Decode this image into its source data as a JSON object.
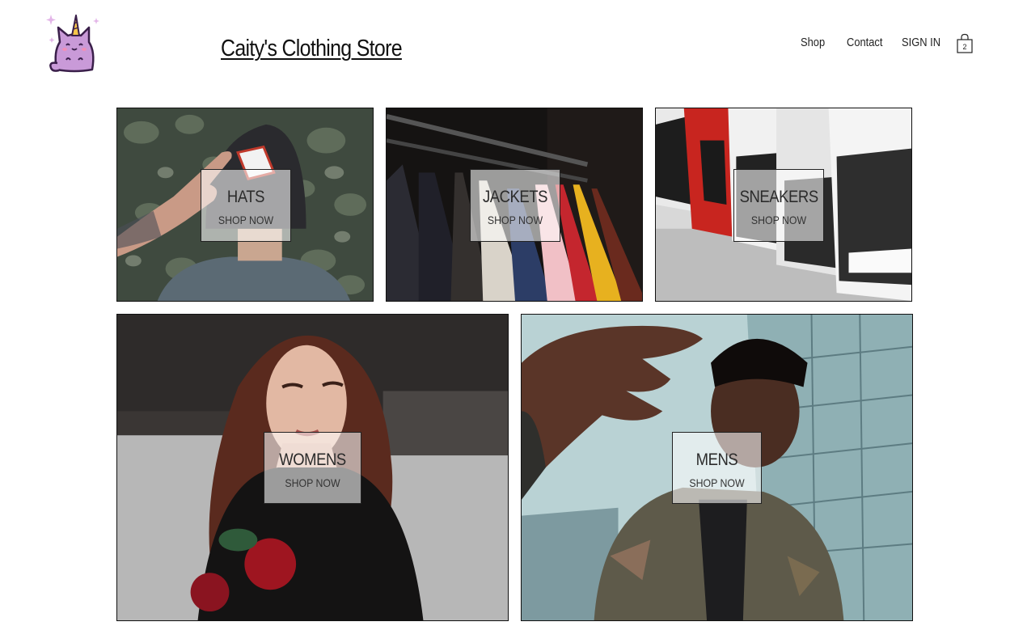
{
  "header": {
    "store_title": "Caity's Clothing Store",
    "logo_icon": "unicorn-cat-logo-icon",
    "nav": {
      "shop": "Shop",
      "contact": "Contact",
      "signin": "SIGN IN"
    },
    "cart": {
      "icon": "shopping-bag-icon",
      "count": "2"
    }
  },
  "categories": [
    {
      "title": "HATS",
      "cta": "SHOP NOW"
    },
    {
      "title": "JACKETS",
      "cta": "SHOP NOW"
    },
    {
      "title": "SNEAKERS",
      "cta": "SHOP NOW"
    },
    {
      "title": "WOMENS",
      "cta": "SHOP NOW"
    },
    {
      "title": "MENS",
      "cta": "SHOP NOW"
    }
  ],
  "colors": {
    "logo_purple": "#c58fd3",
    "logo_outline": "#3a1f4a",
    "text": "#111111"
  }
}
